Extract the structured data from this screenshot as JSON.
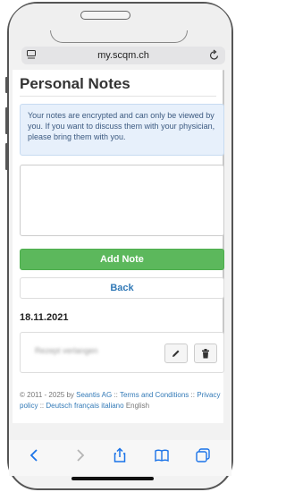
{
  "browser": {
    "url": "my.scqm.ch"
  },
  "page": {
    "title": "Personal Notes",
    "info_message": "Your notes are encrypted and can only be viewed by you. If you want to discuss them with your physician, please bring them with you.",
    "textarea_value": "",
    "add_note_label": "Add Note",
    "back_label": "Back"
  },
  "notes": [
    {
      "date": "18.11.2021",
      "text": "Rezept verlangen"
    }
  ],
  "footer": {
    "copyright": "© 2011 - 2025 by",
    "company": "Seantis AG",
    "sep1": "::",
    "terms": "Terms and Conditions",
    "sep2": "::",
    "privacy": "Privacy policy",
    "sep3": "::",
    "lang_de": "Deutsch",
    "lang_fr": "français",
    "lang_it": "italiano",
    "lang_en": "English"
  },
  "icons": {
    "url_left": "tab-view-icon",
    "url_right": "reload-icon",
    "edit": "pencil-icon",
    "delete": "trash-icon",
    "toolbar": [
      "back-arrow-icon",
      "forward-arrow-icon",
      "share-icon",
      "bookmarks-icon",
      "tabs-icon"
    ]
  },
  "colors": {
    "accent_link": "#337ab7",
    "success": "#5cb85c",
    "info_bg": "#e7f0fb"
  }
}
